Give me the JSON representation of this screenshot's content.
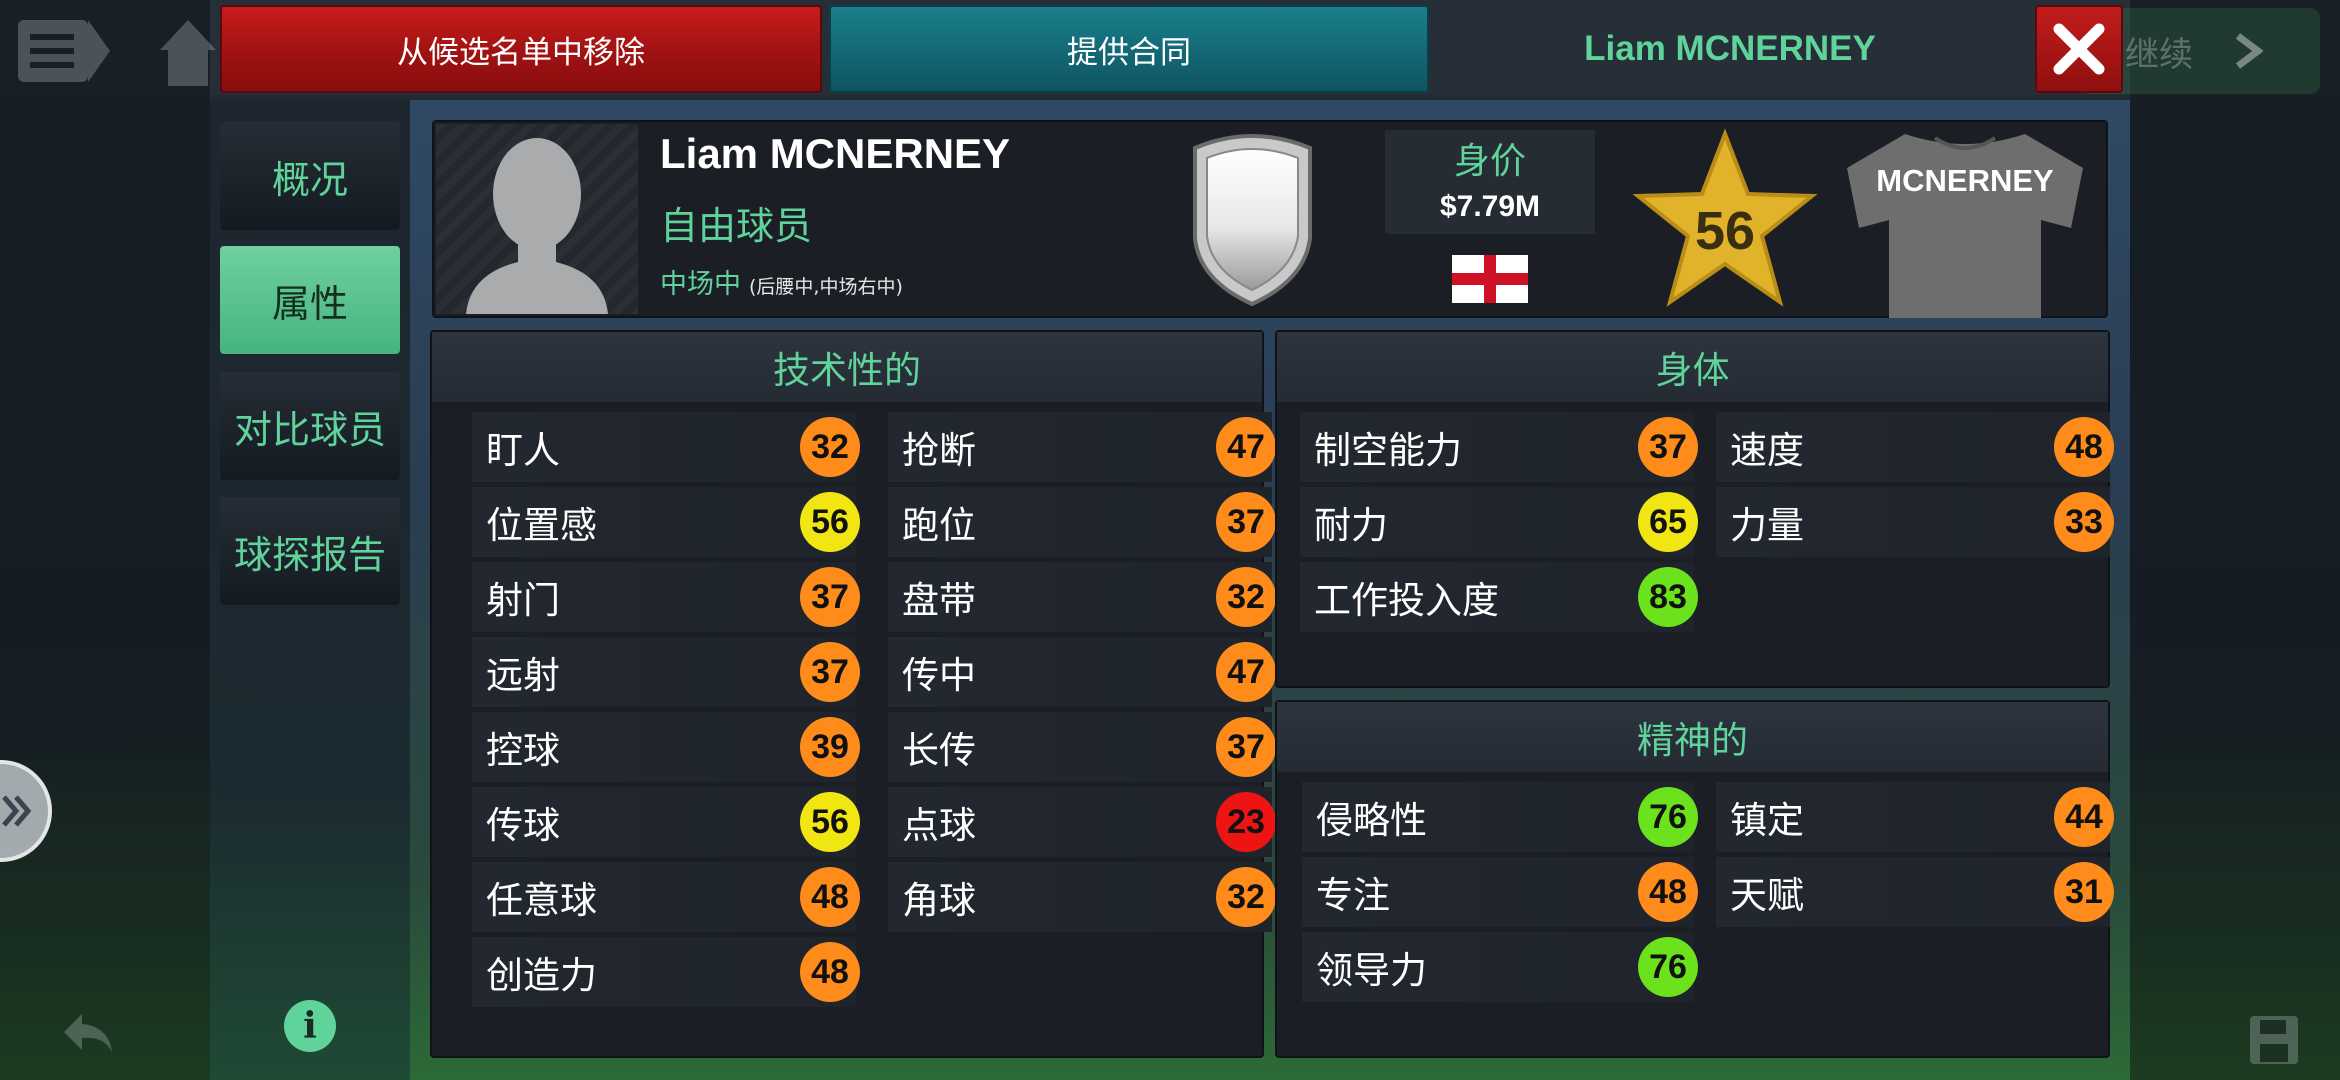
{
  "background": {
    "continue_label": "继续"
  },
  "topbar": {
    "remove_shortlist_label": "从候选名单中移除",
    "offer_contract_label": "提供合同",
    "player_name": "Liam MCNERNEY"
  },
  "nav": {
    "items": [
      {
        "label": "概况",
        "active": false
      },
      {
        "label": "属性",
        "active": true
      },
      {
        "label": "对比球员",
        "active": false
      },
      {
        "label": "球探报告",
        "active": false
      }
    ]
  },
  "player": {
    "name": "Liam MCNERNEY",
    "status": "自由球员",
    "position_main": "中场中",
    "position_alt": "(后腰中,中场右中)",
    "value_label": "身价",
    "value_amount": "$7.79M",
    "nationality_flag": "england-flag",
    "rating": "56",
    "shirt_name": "MCNERNEY"
  },
  "colors": {
    "accent_green": "#5fd39a",
    "tier_red": "#ee1414",
    "tier_orange": "#ff8c1a",
    "tier_yellow": "#f2e612",
    "tier_green": "#6ce21c"
  },
  "technical": {
    "title": "技术性的",
    "left": [
      {
        "label": "盯人",
        "value": "32"
      },
      {
        "label": "位置感",
        "value": "56"
      },
      {
        "label": "射门",
        "value": "37"
      },
      {
        "label": "远射",
        "value": "37"
      },
      {
        "label": "控球",
        "value": "39"
      },
      {
        "label": "传球",
        "value": "56"
      },
      {
        "label": "任意球",
        "value": "48"
      },
      {
        "label": "创造力",
        "value": "48"
      }
    ],
    "right": [
      {
        "label": "抢断",
        "value": "47"
      },
      {
        "label": "跑位",
        "value": "37"
      },
      {
        "label": "盘带",
        "value": "32"
      },
      {
        "label": "传中",
        "value": "47"
      },
      {
        "label": "长传",
        "value": "37"
      },
      {
        "label": "点球",
        "value": "23"
      },
      {
        "label": "角球",
        "value": "32"
      }
    ]
  },
  "physical": {
    "title": "身体",
    "left": [
      {
        "label": "制空能力",
        "value": "37"
      },
      {
        "label": "耐力",
        "value": "65"
      },
      {
        "label": "工作投入度",
        "value": "83"
      }
    ],
    "right": [
      {
        "label": "速度",
        "value": "48"
      },
      {
        "label": "力量",
        "value": "33"
      }
    ]
  },
  "mental": {
    "title": "精神的",
    "left": [
      {
        "label": "侵略性",
        "value": "76"
      },
      {
        "label": "专注",
        "value": "48"
      },
      {
        "label": "领导力",
        "value": "76"
      }
    ],
    "right": [
      {
        "label": "镇定",
        "value": "44"
      },
      {
        "label": "天赋",
        "value": "31"
      }
    ]
  }
}
